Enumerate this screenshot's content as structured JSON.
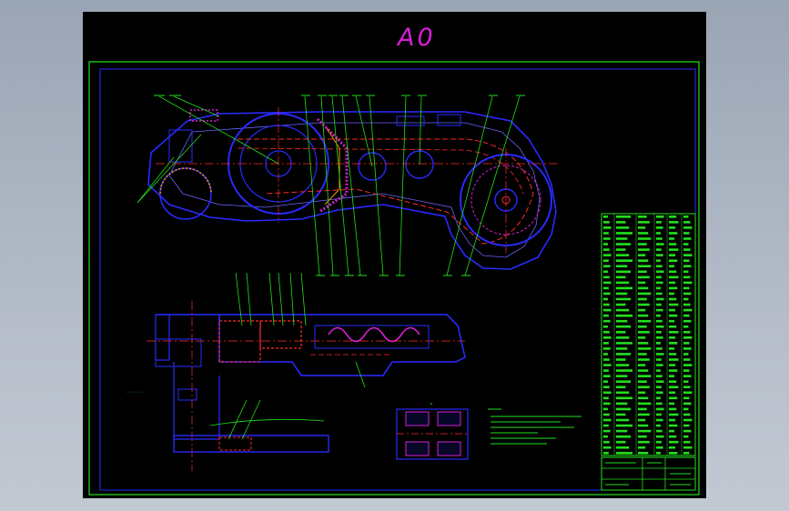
{
  "sheet": {
    "size_label": "A0"
  },
  "colors": {
    "background": "#000000",
    "frame": "#22e01c",
    "inner_frame": "#2a2aff",
    "outline": "#2a2aff",
    "centerline": "#ff2a2a",
    "leader": "#22e01c",
    "size_label": "#d61fd6",
    "accent": "#e6e600"
  },
  "components": {
    "plan_view": "excavating-arm-plan-view",
    "section_view": "longitudinal-section-view",
    "detail_view": "gear-detail-view",
    "parts_list": "parts-list-table",
    "title_block": "title-block"
  }
}
